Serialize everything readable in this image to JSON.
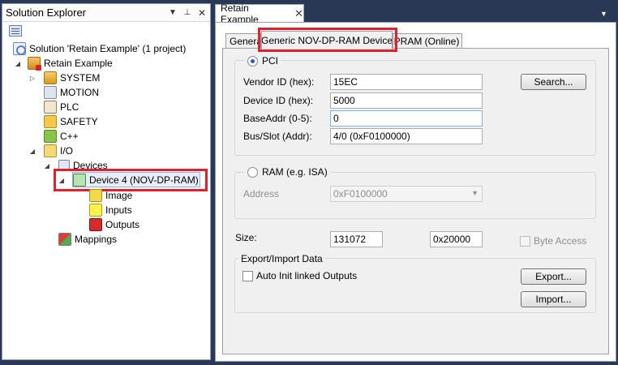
{
  "solution_explorer": {
    "title": "Solution Explorer",
    "title_icons": [
      "dropdown-arrow-icon",
      "pin-icon",
      "close-icon"
    ],
    "tree": {
      "solution": "Solution 'Retain Example' (1 project)",
      "project": "Retain Example",
      "system": "SYSTEM",
      "motion": "MOTION",
      "plc": "PLC",
      "safety": "SAFETY",
      "cpp": "C++",
      "io": "I/O",
      "devices": "Devices",
      "device": "Device 4 (NOV-DP-RAM)",
      "image": "Image",
      "inputs": "Inputs",
      "outputs": "Outputs",
      "mappings": "Mappings"
    }
  },
  "document": {
    "tab_title": "Retain Example",
    "tabs": [
      "General",
      "Generic NOV-DP-RAM Device",
      "DPRAM (Online)"
    ],
    "active_tab": 1,
    "pci_label": "PCI",
    "pci_selected": true,
    "vendor_id_label": "Vendor ID (hex):",
    "vendor_id_value": "15EC",
    "device_id_label": "Device ID (hex):",
    "device_id_value": "5000",
    "baseaddr_label": "BaseAddr (0-5):",
    "baseaddr_value": "0",
    "busslot_label": "Bus/Slot (Addr):",
    "busslot_value": "4/0 (0xF0100000)",
    "search_button": "Search...",
    "ram_label": "RAM (e.g. ISA)",
    "ram_selected": false,
    "address_label": "Address",
    "address_value": "0xF0100000",
    "size_label": "Size:",
    "size_dec_value": "131072",
    "size_hex_value": "0x20000",
    "byte_access_label": "Byte Access",
    "export_group_title": "Export/Import Data",
    "auto_init_label": "Auto Init linked Outputs",
    "export_button": "Export...",
    "import_button": "Import..."
  },
  "colors": {
    "ide_background": "#293955",
    "highlight_red": "#e0202a"
  }
}
